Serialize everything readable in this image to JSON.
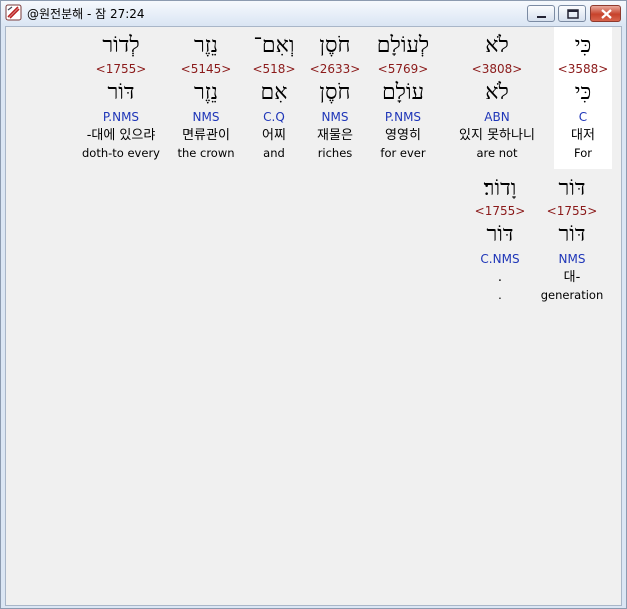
{
  "window": {
    "title": "@원전분해 - 잠 27:24"
  },
  "row1": [
    {
      "surface": "כִּי",
      "strong": "<3588>",
      "lemma": "כִּי",
      "parse": "C",
      "korean": "대저",
      "english": "For",
      "selected": true
    },
    {
      "surface": "לֹא",
      "strong": "<3808>",
      "lemma": "לֹא",
      "parse": "ABN",
      "korean": "있지 못하나니",
      "english": "are not",
      "selected": false
    },
    {
      "surface": "לְעוֹלָם",
      "strong": "<5769>",
      "lemma": "עוֹלָם",
      "parse": "P.NMS",
      "korean": "영영히",
      "english": "for ever",
      "selected": false
    },
    {
      "surface": "חֹסֶן",
      "strong": "<2633>",
      "lemma": "חֹסֶן",
      "parse": "NMS",
      "korean": "재물은",
      "english": "riches",
      "selected": false
    },
    {
      "surface": "וְאִם־",
      "strong": "<518>",
      "lemma": "אִם",
      "parse": "C.Q",
      "korean": "어찌",
      "english": "and",
      "selected": false
    },
    {
      "surface": "נֵזֶר",
      "strong": "<5145>",
      "lemma": "נֵזֶר",
      "parse": "NMS",
      "korean": "면류관이",
      "english": "the crown",
      "selected": false
    },
    {
      "surface": "לְדוֹר",
      "strong": "<1755>",
      "lemma": "דּוֹר",
      "parse": "P.NMS",
      "korean": "-대에 있으랴",
      "english": "doth-to every",
      "selected": false
    }
  ],
  "row2": [
    {
      "surface": "דּוֹר",
      "strong": "<1755>",
      "lemma": "דּוֹר",
      "parse": "NMS",
      "korean": "대-",
      "english": "generation",
      "selected": false
    },
    {
      "surface": "וָדוֹר׃",
      "strong": "<1755>",
      "lemma": "דּוֹר",
      "parse": "C.NMS",
      "korean": ".",
      "english": ".",
      "selected": false
    }
  ]
}
